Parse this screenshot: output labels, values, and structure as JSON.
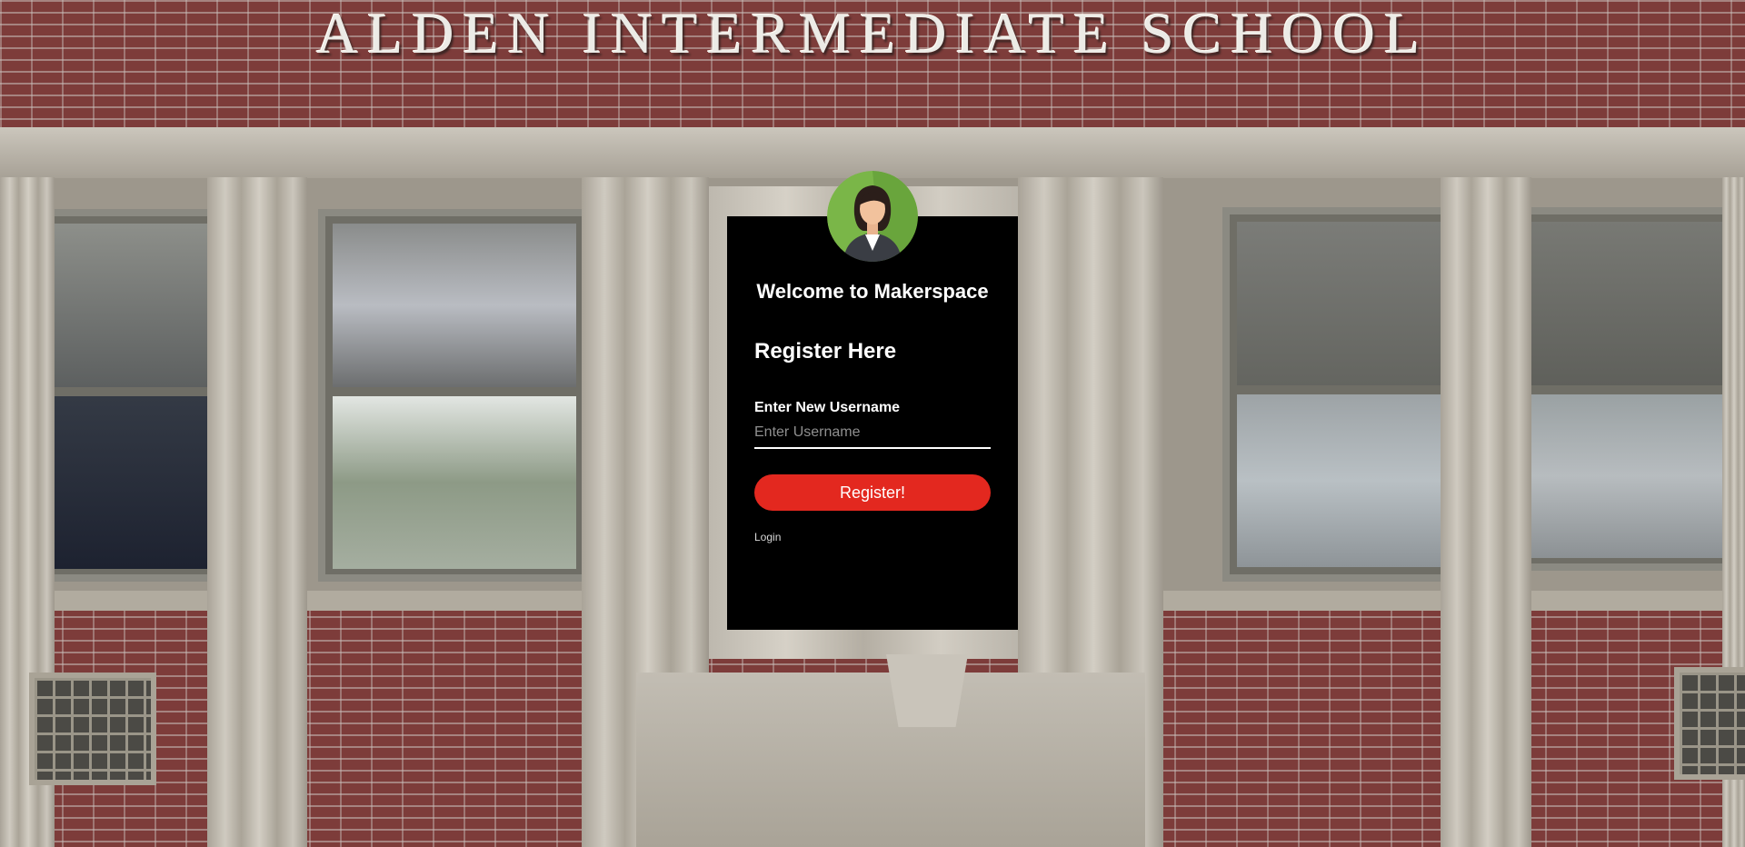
{
  "background": {
    "sign_text": "ALDEN  INTERMEDIATE  SCHOOL"
  },
  "card": {
    "avatar_icon": "user-avatar-icon",
    "welcome": "Welcome to Makerspace",
    "heading": "Register Here",
    "username_label": "Enter New Username",
    "username_placeholder": "Enter Username",
    "username_value": "",
    "register_button": "Register!",
    "login_link": "Login"
  },
  "colors": {
    "card_bg": "#000000",
    "button": "#e3281f",
    "avatar_bg": "#7ab648"
  }
}
